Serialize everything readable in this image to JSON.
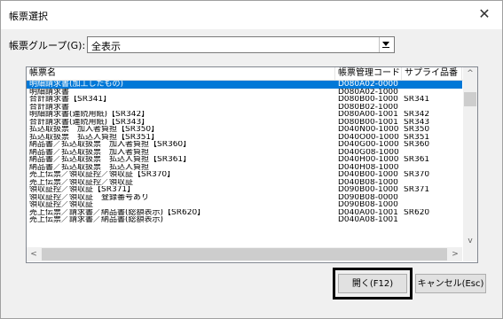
{
  "window": {
    "title": "帳票選択",
    "close_glyph": "✕"
  },
  "group": {
    "label": "帳票グループ(G):",
    "value": "全表示"
  },
  "list": {
    "columns": [
      "帳票名",
      "帳票管理コード",
      "サプライ品番"
    ],
    "rows": [
      {
        "name": "明細請求書(加工したもの)",
        "code": "D080A02-0000",
        "supply": "",
        "selected": true
      },
      {
        "name": "明細請求書",
        "code": "D080A02-1000",
        "supply": ""
      },
      {
        "name": "合計請求書【SR341】",
        "code": "D080B00-1000",
        "supply": "SR341"
      },
      {
        "name": "合計請求書",
        "code": "D080B02-1000",
        "supply": ""
      },
      {
        "name": "明細請求書(連続用紙)【SR342】",
        "code": "D080A00-1001",
        "supply": "SR342"
      },
      {
        "name": "合計請求書(連続用紙)【SR343】",
        "code": "D080B00-1001",
        "supply": "SR343"
      },
      {
        "name": "払込取扱票　加入者負担【SR350】",
        "code": "D040N00-1000",
        "supply": "SR350"
      },
      {
        "name": "払込取扱票　払込人負担【SR351】",
        "code": "D040O00-1000",
        "supply": "SR351"
      },
      {
        "name": "納品書／払込取扱票　加入者負担【SR360】",
        "code": "D040G00-1000",
        "supply": "SR360"
      },
      {
        "name": "納品書／払込取扱票　加入者負担",
        "code": "D040G08-1000",
        "supply": ""
      },
      {
        "name": "納品書／払込取扱票　払込人負担【SR361】",
        "code": "D040H00-1000",
        "supply": "SR361"
      },
      {
        "name": "納品書／払込取扱票　払込人負担",
        "code": "D040H08-1000",
        "supply": ""
      },
      {
        "name": "売上伝票／領収証控／領収証【SR370】",
        "code": "D040B00-1000",
        "supply": "SR370"
      },
      {
        "name": "売上伝票／領収証控／領収証",
        "code": "D040B08-1000",
        "supply": ""
      },
      {
        "name": "領収証控／領収証【SR371】",
        "code": "D090B00-1000",
        "supply": "SR371"
      },
      {
        "name": "領収証控／領収証　登録番号あり",
        "code": "D090B08-0000",
        "supply": ""
      },
      {
        "name": "領収証控／領収証",
        "code": "D090B08-1000",
        "supply": ""
      },
      {
        "name": "売上伝票／請求書／納品書(総額表示)【SR620】",
        "code": "D040A00-1001",
        "supply": "SR620"
      },
      {
        "name": "売上伝票／請求書／納品書(総額表示)",
        "code": "D040A08-1001",
        "supply": ""
      }
    ]
  },
  "scroll": {
    "up": "^",
    "down": "v",
    "left": "<",
    "right": ">"
  },
  "buttons": {
    "open": "開く(F12)",
    "cancel": "キャンセル(Esc)"
  },
  "colors": {
    "selection": "#0078d7",
    "dialog_bg": "#f0f0f0"
  }
}
